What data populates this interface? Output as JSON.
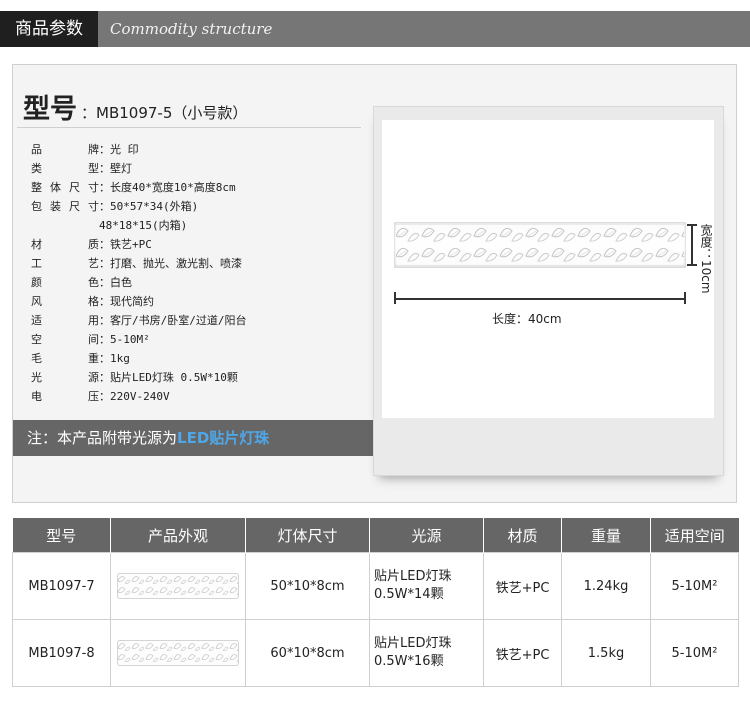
{
  "header": {
    "title_cn": "商品参数",
    "title_en": "Commodity structure",
    "colors": {
      "bar": "#767676",
      "tab": "#1f1f1f"
    }
  },
  "model": {
    "label": "型号",
    "value": "：MB1097-5（小号款）"
  },
  "specs": [
    {
      "key": "品　　牌",
      "sep": "：",
      "value": "光 印"
    },
    {
      "key": "类　　型",
      "sep": "：",
      "value": "壁灯"
    },
    {
      "key": "整体尺寸",
      "sep": "：",
      "value": "长度40*宽度10*高度8cm"
    },
    {
      "key": "包装尺寸",
      "sep": "：",
      "value": "50*57*34(外箱)"
    },
    {
      "key": "",
      "sep": "",
      "value": "48*18*15(内箱)"
    },
    {
      "key": "材　　质",
      "sep": "：",
      "value": "铁艺+PC"
    },
    {
      "key": "工　　艺",
      "sep": "：",
      "value": "打磨、抛光、激光割、喷漆"
    },
    {
      "key": "颜　　色",
      "sep": "：",
      "value": "白色"
    },
    {
      "key": "风　　格",
      "sep": "：",
      "value": "现代简约"
    },
    {
      "key": "适　　用",
      "sep": "：",
      "value": "客厅/书房/卧室/过道/阳台"
    },
    {
      "key": "空　　间",
      "sep": "：",
      "value": "5-10M²"
    },
    {
      "key": "毛　　重",
      "sep": "：",
      "value": "1kg"
    },
    {
      "key": "光　　源",
      "sep": "：",
      "value": "贴片LED灯珠 0.5W*10颗"
    },
    {
      "key": "电　　压",
      "sep": "：",
      "value": "220V-240V"
    }
  ],
  "note": {
    "prefix": "注：本产品附带光源为",
    "highlight": "LED贴片灯珠",
    "highlight_color": "#4fa7e8"
  },
  "dimensions": {
    "length_label": "长度：40cm",
    "width_label": "宽度：10cm"
  },
  "table": {
    "headers": [
      "型号",
      "产品外观",
      "灯体尺寸",
      "光源",
      "材质",
      "重量",
      "适用空间"
    ],
    "rows": [
      {
        "model": "MB1097-7",
        "size": "50*10*8cm",
        "source_line1": "贴片LED灯珠",
        "source_line2": "0.5W*14颗",
        "material": "铁艺+PC",
        "weight": "1.24kg",
        "space": "5-10M²"
      },
      {
        "model": "MB1097-8",
        "size": "60*10*8cm",
        "source_line1": "贴片LED灯珠",
        "source_line2": "0.5W*16颗",
        "material": "铁艺+PC",
        "weight": "1.5kg",
        "space": "5-10M²"
      }
    ]
  }
}
